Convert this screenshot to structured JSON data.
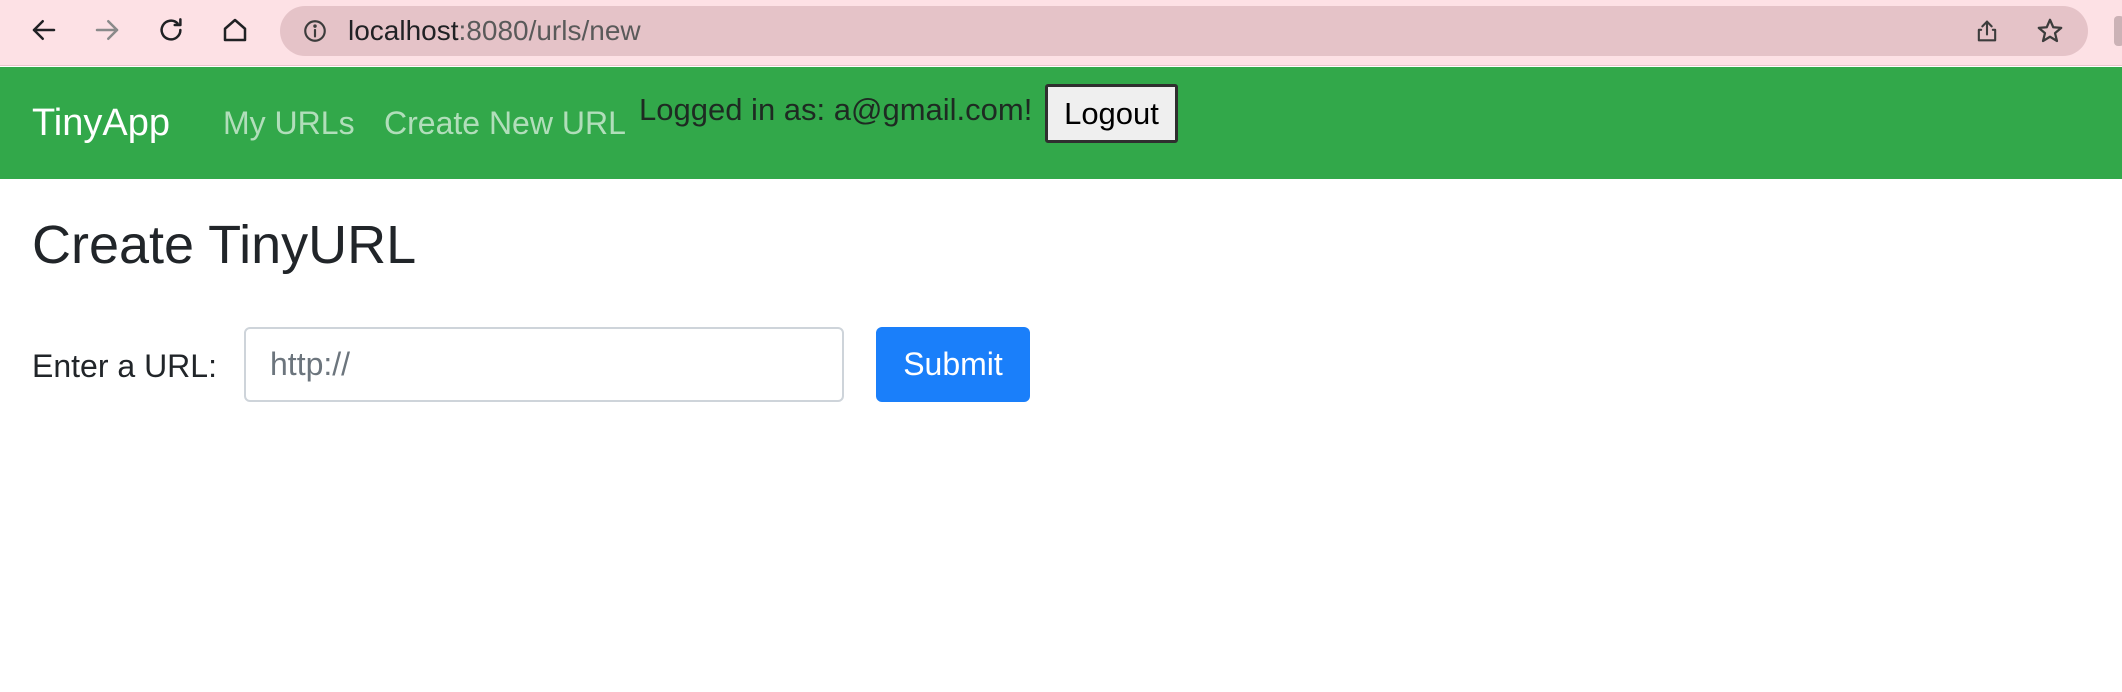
{
  "browser": {
    "url_host": "localhost",
    "url_rest": ":8080/urls/new",
    "icons": {
      "back": "arrow-left-icon",
      "forward": "arrow-right-icon",
      "reload": "reload-icon",
      "home": "home-icon",
      "site_info": "info-circle-icon",
      "share": "share-icon",
      "bookmark": "star-icon"
    },
    "colors": {
      "toolbar_bg": "#fde1e5",
      "omnibox_bg": "#e5c3c8"
    }
  },
  "navbar": {
    "brand": "TinyApp",
    "links": [
      {
        "label": "My URLs"
      },
      {
        "label": "Create New URL"
      }
    ],
    "login_status": "Logged in as: a@gmail.com!",
    "logout_label": "Logout",
    "colors": {
      "background": "#32a84a"
    }
  },
  "main": {
    "title": "Create TinyURL",
    "form": {
      "label": "Enter a URL:",
      "input_value": "",
      "input_placeholder": "http://",
      "submit_label": "Submit"
    },
    "colors": {
      "primary": "#1a7ffa"
    }
  }
}
